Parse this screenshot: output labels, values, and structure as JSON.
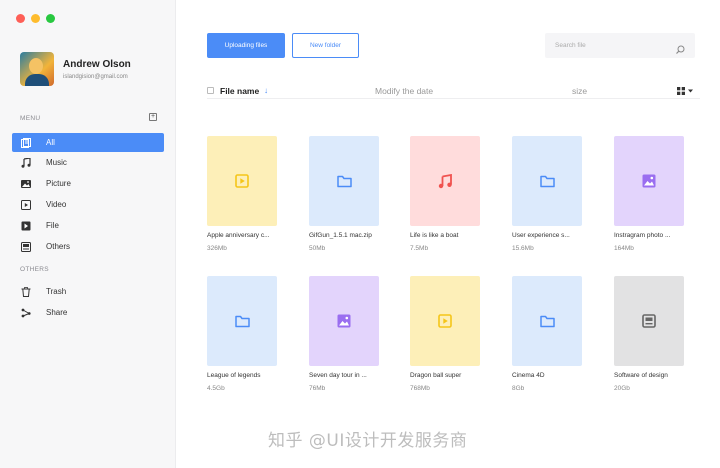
{
  "window_controls": {
    "colors": [
      "#fe5f57",
      "#febc2e",
      "#28c840"
    ]
  },
  "profile": {
    "name": "Andrew Olson",
    "email": "islandgision@gmail.com"
  },
  "sidebar": {
    "menu_label": "MENU",
    "menu_add_symbol": "+",
    "others_label": "OTHERS",
    "items": [
      {
        "label": "All",
        "icon": "all-files-icon",
        "active": true
      },
      {
        "label": "Music",
        "icon": "music-icon"
      },
      {
        "label": "Picture",
        "icon": "picture-icon"
      },
      {
        "label": "Video",
        "icon": "video-icon"
      },
      {
        "label": "File",
        "icon": "file-icon"
      },
      {
        "label": "Others",
        "icon": "others-icon"
      }
    ],
    "other_items": [
      {
        "label": "Trash",
        "icon": "trash-icon"
      },
      {
        "label": "Share",
        "icon": "share-icon"
      }
    ]
  },
  "toolbar": {
    "upload_label": "Uploading files",
    "new_folder_label": "New folder"
  },
  "search": {
    "placeholder": "Search file"
  },
  "table_header": {
    "name": "File name",
    "sort_arrow": "↓",
    "date": "Modify the date",
    "size": "size"
  },
  "files": [
    {
      "name": "Apple anniversary c...",
      "size": "326Mb",
      "type": "video",
      "bg": "#fdefb8",
      "icon_color": "#f5c518"
    },
    {
      "name": "GifGun_1.5.1 mac.zip",
      "size": "50Mb",
      "type": "folder",
      "bg": "#dceafc",
      "icon_color": "#4b8cf7"
    },
    {
      "name": "Life is like a boat",
      "size": "7.5Mb",
      "type": "music",
      "bg": "#ffdcdc",
      "icon_color": "#f0524f"
    },
    {
      "name": "User experience s...",
      "size": "15.6Mb",
      "type": "folder",
      "bg": "#dceafc",
      "icon_color": "#4b8cf7"
    },
    {
      "name": "Instragram photo ...",
      "size": "164Mb",
      "type": "picture",
      "bg": "#e3d4fc",
      "icon_color": "#9a6ef0"
    },
    {
      "name": "League of legends",
      "size": "4.5Gb",
      "type": "folder",
      "bg": "#dceafc",
      "icon_color": "#4b8cf7"
    },
    {
      "name": "Seven day tour in ...",
      "size": "76Mb",
      "type": "picture",
      "bg": "#e3d4fc",
      "icon_color": "#9a6ef0"
    },
    {
      "name": "Dragon ball super",
      "size": "768Mb",
      "type": "video",
      "bg": "#fdefb8",
      "icon_color": "#f5c518"
    },
    {
      "name": "Cinema 4D",
      "size": "8Gb",
      "type": "folder",
      "bg": "#dceafc",
      "icon_color": "#4b8cf7"
    },
    {
      "name": "Software of design",
      "size": "20Gb",
      "type": "archive",
      "bg": "#e2e2e3",
      "icon_color": "#666666"
    }
  ],
  "watermark": "知乎 @UI设计开发服务商",
  "accent": "#4b8cf7"
}
